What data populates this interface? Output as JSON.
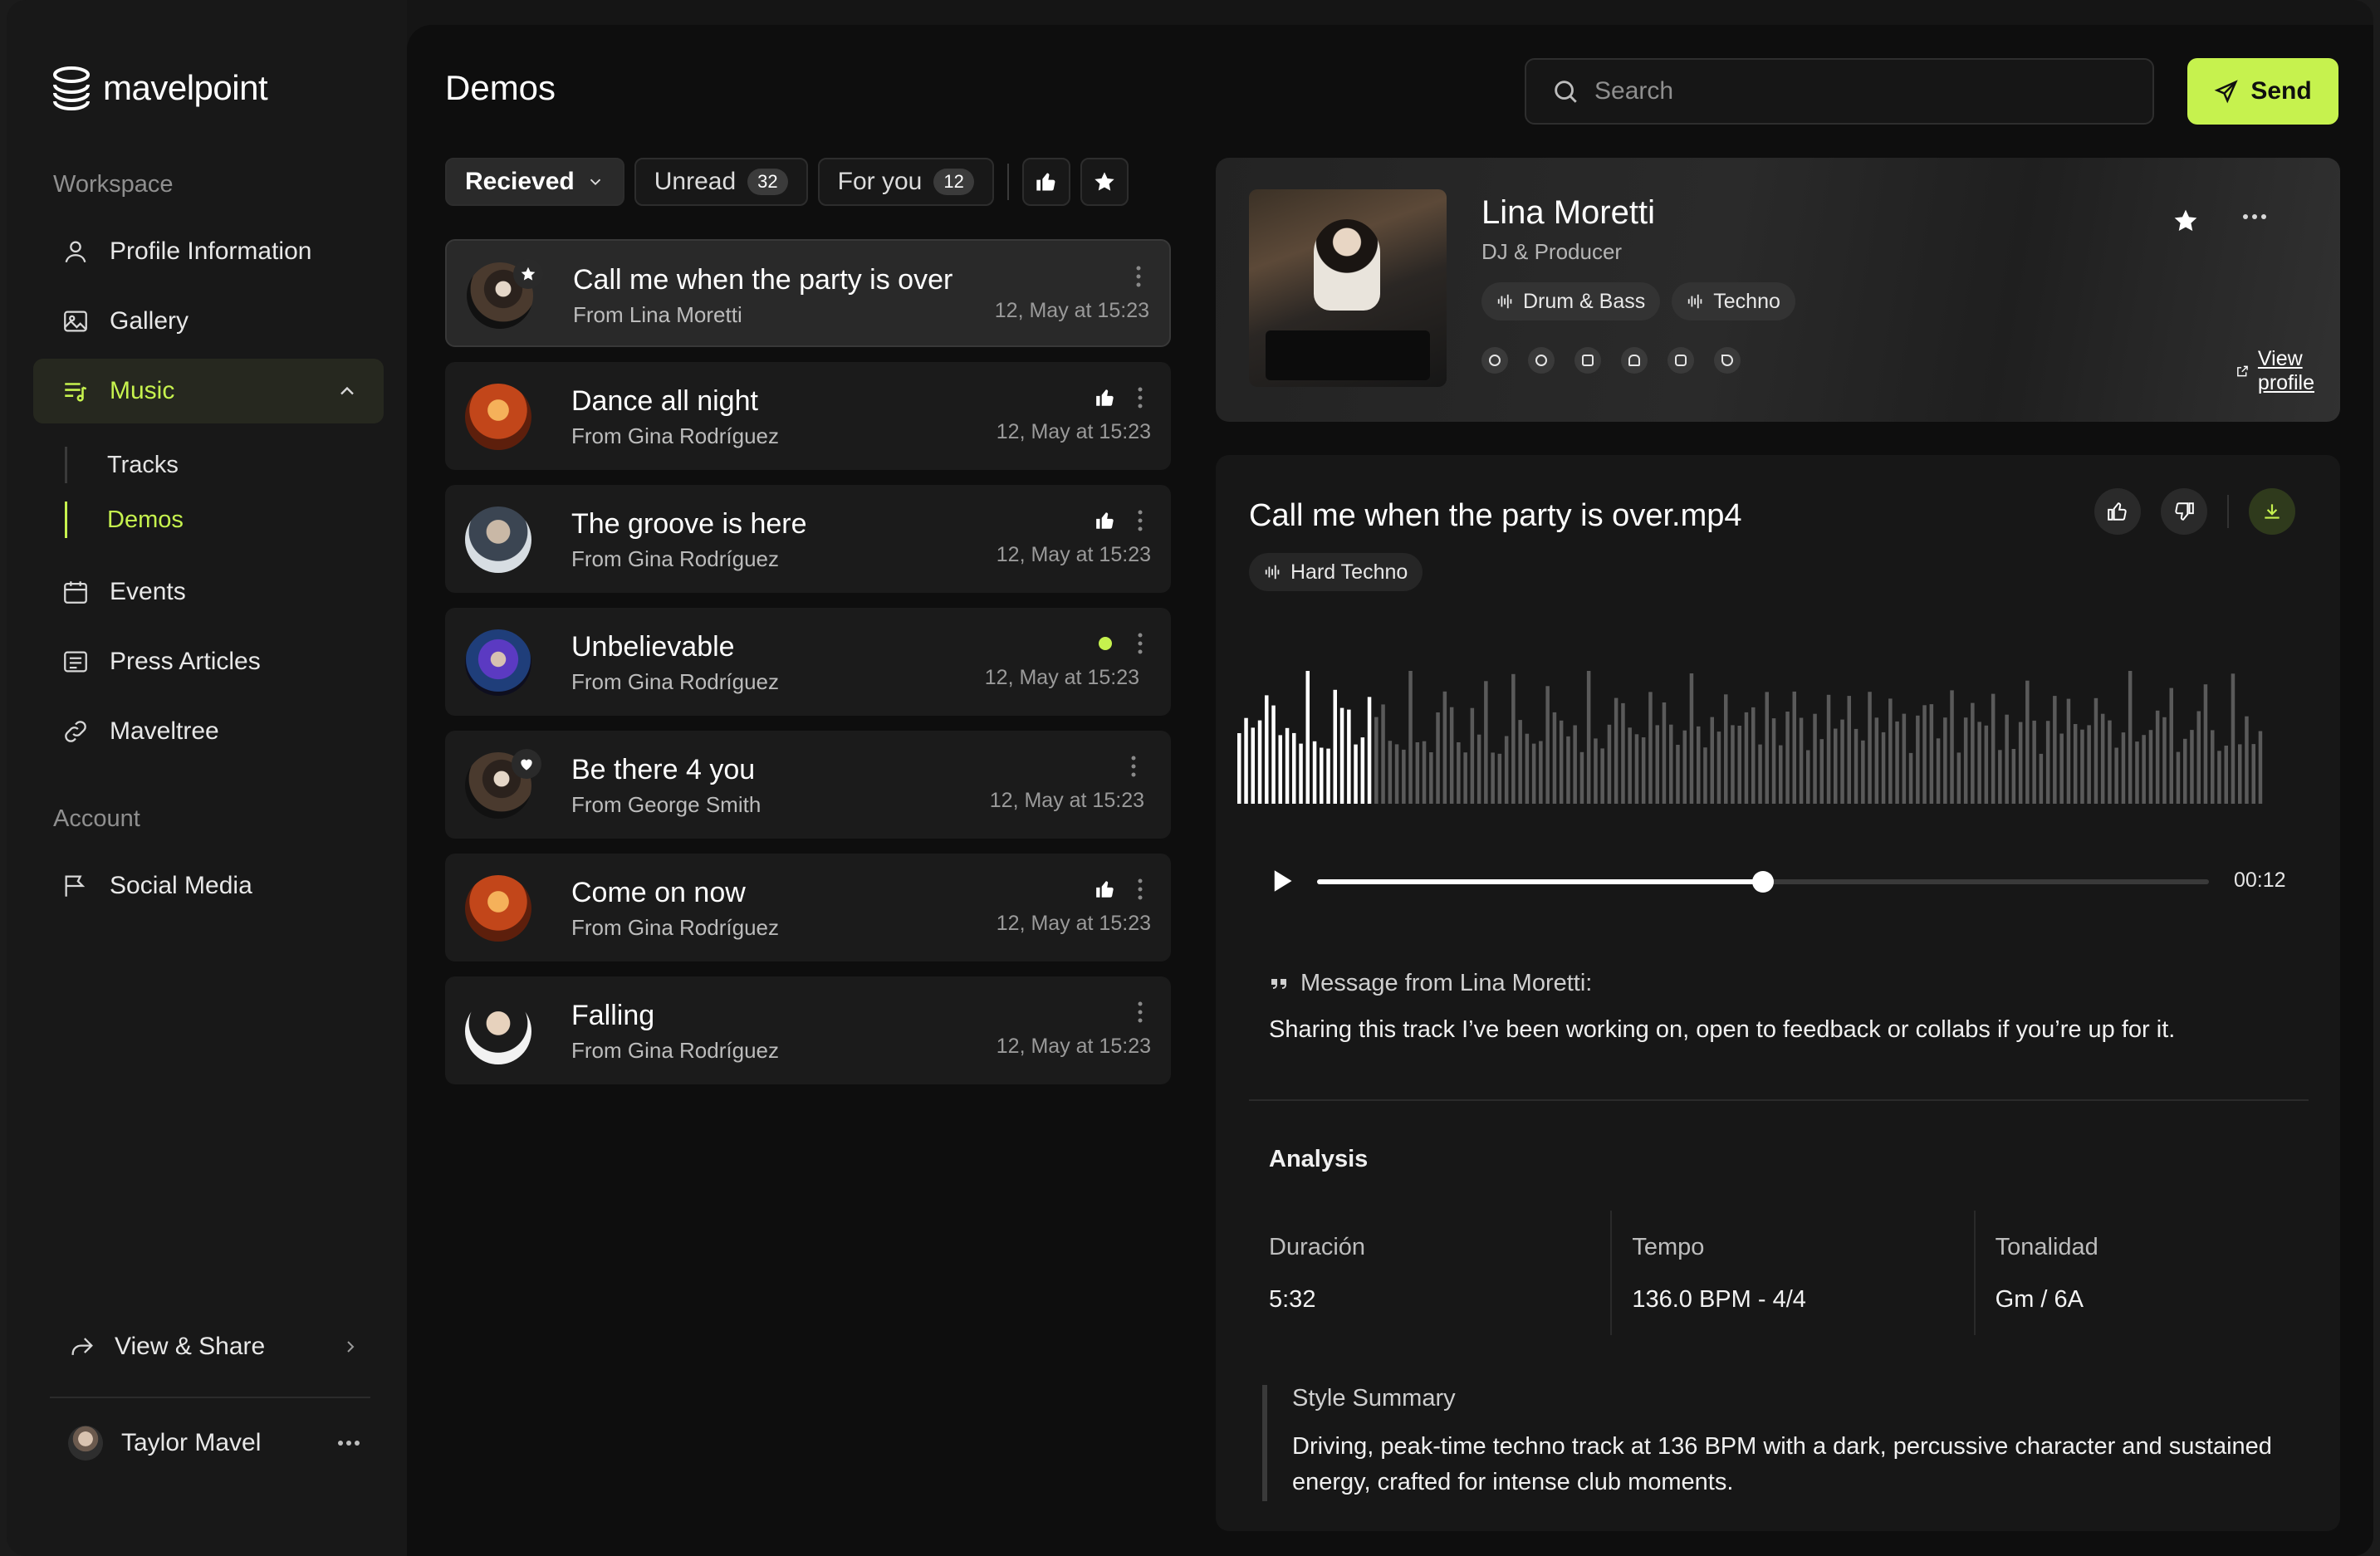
{
  "brand": {
    "name": "mavelpoint"
  },
  "sidebar": {
    "workspace_label": "Workspace",
    "account_label": "Account",
    "items": [
      {
        "label": "Profile Information",
        "icon": "user-icon"
      },
      {
        "label": "Gallery",
        "icon": "image-icon"
      },
      {
        "label": "Music",
        "icon": "music-list-icon"
      },
      {
        "label": "Events",
        "icon": "calendar-icon"
      },
      {
        "label": "Press Articles",
        "icon": "article-icon"
      },
      {
        "label": "Maveltree",
        "icon": "link-icon"
      }
    ],
    "music_sub": [
      {
        "label": "Tracks"
      },
      {
        "label": "Demos"
      }
    ],
    "account_items": [
      {
        "label": "Social Media",
        "icon": "flag-icon"
      }
    ],
    "view_share": "View & Share",
    "user": {
      "name": "Taylor Mavel"
    }
  },
  "header": {
    "title": "Demos",
    "search_placeholder": "Search",
    "send_label": "Send"
  },
  "filters": {
    "received": "Recieved",
    "unread": "Unread",
    "unread_count": "32",
    "for_you": "For you",
    "for_you_count": "12"
  },
  "demos": [
    {
      "title": "Call me when the party is over",
      "from": "From Lina Moretti",
      "date": "12, May at 15:23"
    },
    {
      "title": "Dance all night",
      "from": "From Gina Rodríguez",
      "date": "12, May at 15:23"
    },
    {
      "title": "The groove is here",
      "from": "From Gina Rodríguez",
      "date": "12, May at 15:23"
    },
    {
      "title": "Unbelievable",
      "from": "From Gina Rodríguez",
      "date": "12, May at 15:23"
    },
    {
      "title": "Be there 4 you",
      "from": "From George Smith",
      "date": "12, May at 15:23"
    },
    {
      "title": "Come on now",
      "from": "From Gina Rodríguez",
      "date": "12, May at 15:23"
    },
    {
      "title": "Falling",
      "from": "From Gina Rodríguez",
      "date": "12, May at 15:23"
    }
  ],
  "profile": {
    "name": "Lina Moretti",
    "role": "DJ & Producer",
    "tags": [
      "Drum & Bass",
      "Techno"
    ],
    "socials": [
      "globe-icon",
      "spotify-icon",
      "youtube-icon",
      "soundcloud-icon",
      "instagram-icon",
      "tiktok-icon"
    ],
    "view_profile": "View profile"
  },
  "player": {
    "file_name": "Call me when the party is over.mp4",
    "genre": "Hard Techno",
    "time": "00:12",
    "progress": 0.5,
    "played_fraction": 0.13,
    "message_header": "Message from Lina Moretti:",
    "message": "Sharing this track I’ve been working on, open to feedback or collabs if you’re up for it.",
    "analysis_title": "Analysis",
    "stats": [
      {
        "label": "Duración",
        "value": "5:32"
      },
      {
        "label": "Tempo",
        "value": "136.0 BPM - 4/4"
      },
      {
        "label": "Tonalidad",
        "value": "Gm / 6A"
      }
    ],
    "summary_label": "Style Summary",
    "summary": "Driving, peak-time techno track at 136 BPM with a dark, percussive character and sustained energy, crafted for intense club moments."
  },
  "colors": {
    "accent": "#c6f24e",
    "panel": "#0e0e0e"
  }
}
